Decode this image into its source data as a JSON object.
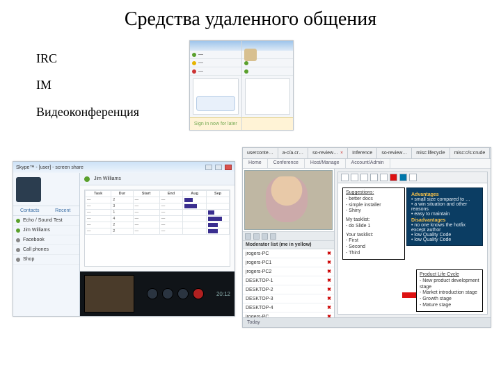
{
  "title": "Средства удаленного общения",
  "bullets": {
    "irc": "IRC",
    "im": "IM",
    "video": "Видеоконференция"
  },
  "im_window": {
    "signin": "Sign in now for later",
    "contacts": [
      "—",
      "—",
      "—"
    ]
  },
  "skype": {
    "window_title": "Skype™ - [user] - screen share",
    "contact_name": "Jim Williams",
    "tabs": {
      "contacts": "Contacts",
      "recent": "Recent"
    },
    "side_items": [
      "Echo / Sound Test",
      "Jim Williams",
      "Facebook",
      "Call phones",
      "Shop"
    ],
    "call_time": "20:12",
    "sheet_headers": [
      "Task",
      "Dur",
      "Start",
      "End",
      "Aug",
      "Sep"
    ]
  },
  "collab": {
    "browser_tabs": [
      "userconte…",
      "a-c/a.cr…",
      "so-review…",
      "Inference",
      "so-review…",
      "misc:lifecycle",
      "misc:c/s:crude"
    ],
    "sub_tabs": [
      "Home",
      "Conference",
      "Host/Manage",
      "Account/Admin"
    ],
    "participants_header": "Moderator list (me in yellow)",
    "participants": [
      "jrogers-PC",
      "jrogers-PC1",
      "jrogers-PC2",
      "DESKTOP-1",
      "DESKTOP-2",
      "DESKTOP-3",
      "DESKTOP-4",
      "jrogers-PC"
    ],
    "note1": {
      "heading": "Suggestions:",
      "items": [
        "better docs",
        "simple installer",
        "Shiny"
      ],
      "heading2": "My tasklist:",
      "items2": [
        "do Slide 1"
      ],
      "heading3": "Your tasklist:",
      "items3": [
        "First",
        "Second",
        "Third"
      ]
    },
    "panel": {
      "h1": "Advantages",
      "a_items": [
        "small size compared to …",
        "a win situation and other reasons",
        "easy to maintain"
      ],
      "h2": "Disadvantages",
      "d_items": [
        "no one knows the hotfix except author",
        "low Quality Code",
        "low Quality Code"
      ]
    },
    "note2": {
      "title": "Product Life Cycle",
      "items": [
        "New product development stage",
        "Market introduction stage",
        "Growth stage",
        "Mature stage"
      ]
    },
    "footer": "Today"
  }
}
